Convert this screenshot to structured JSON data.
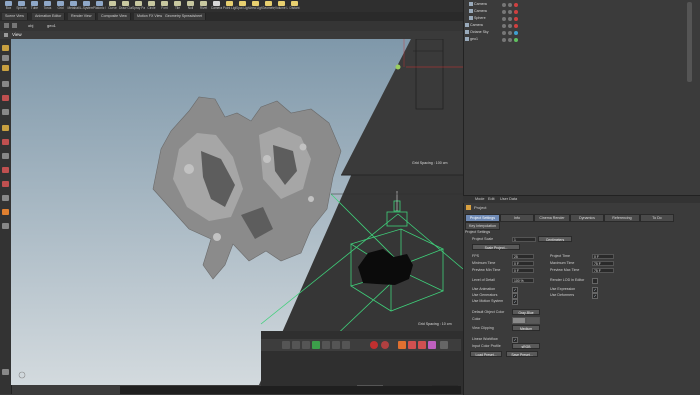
{
  "shelf": {
    "tools": [
      {
        "label": "Box",
        "icon": "box-icon",
        "color": "#8fa8c8"
      },
      {
        "label": "Sphere",
        "icon": "sphere-icon",
        "color": "#8fa8c8"
      },
      {
        "label": "Tube",
        "icon": "tube-icon",
        "color": "#8fa8c8"
      },
      {
        "label": "Torus",
        "icon": "torus-icon",
        "color": "#8fa8c8"
      },
      {
        "label": "Grid",
        "icon": "grid-icon",
        "color": "#8fa8c8"
      },
      {
        "label": "Metaball",
        "icon": "metaball-icon",
        "color": "#8fa8c8"
      },
      {
        "label": "L-System",
        "icon": "lsystem-icon",
        "color": "#8fa8c8"
      },
      {
        "label": "Platonic Sol",
        "icon": "platonic-icon",
        "color": "#8fa8c8"
      },
      {
        "label": "Curve",
        "icon": "curve-icon",
        "color": "#c8c8a0"
      },
      {
        "label": "Draw Curve",
        "icon": "draw-curve-icon",
        "color": "#c8c8a0"
      },
      {
        "label": "Spray Paint",
        "icon": "spray-paint-icon",
        "color": "#c8c8a0"
      },
      {
        "label": "Circle",
        "icon": "circle-icon",
        "color": "#c8c8a0"
      },
      {
        "label": "Font",
        "icon": "font-icon",
        "color": "#c8c8a0"
      },
      {
        "label": "Tile",
        "icon": "tile-icon",
        "color": "#c8c8a0"
      },
      {
        "label": "Null",
        "icon": "null-icon",
        "color": "#c8c8a0"
      },
      {
        "label": "Rivet",
        "icon": "rivet-icon",
        "color": "#c8c8a0"
      },
      {
        "label": "Camera",
        "icon": "camera-icon",
        "color": "#d8d8d8"
      },
      {
        "label": "Point Light",
        "icon": "point-light-icon",
        "color": "#e8d070"
      },
      {
        "label": "Spot Light",
        "icon": "spot-light-icon",
        "color": "#e8d070"
      },
      {
        "label": "Area Light",
        "icon": "area-light-icon",
        "color": "#e8d070"
      },
      {
        "label": "Geometry L",
        "icon": "geometry-light-icon",
        "color": "#e8d070"
      },
      {
        "label": "Volume Light",
        "icon": "volume-light-icon",
        "color": "#e8d070"
      },
      {
        "label": "Distant",
        "icon": "distant-light-icon",
        "color": "#e8d070"
      }
    ]
  },
  "tabs": [
    "Scene View",
    "Animation Editor",
    "Render View",
    "Composite View",
    "Motion FX View",
    "Geometry Spreadsheet"
  ],
  "path": {
    "node": "obj",
    "geo": "geo1"
  },
  "viewport": {
    "title": "View",
    "grid_spacing_top": "Grid Spacing : 100 cm",
    "grid_spacing_bottom": "Grid Spacing : 10 cm"
  },
  "outliner": {
    "items": [
      {
        "name": "Camera",
        "color": "#d04040"
      },
      {
        "name": "Camera",
        "color": "#d04040"
      },
      {
        "name": "Sphere",
        "color": "#d04040"
      },
      {
        "name": "Camera",
        "color": "#d04040"
      },
      {
        "name": "Octane Sky",
        "color": "#40a0d0"
      },
      {
        "name": "geo1",
        "color": "#60c060"
      }
    ]
  },
  "params": {
    "menu": [
      "Mode",
      "Edit",
      "User Data"
    ],
    "header": "Project",
    "tabs": [
      "Project Settings",
      "Info",
      "Cinema Render",
      "Dynamics",
      "Referencing",
      "To Do"
    ],
    "subtab": "Key Interpolation",
    "section": "Project Settings",
    "project_scale_label": "Project Scale",
    "project_scale_value": "1",
    "project_scale_unit": "Centimeters",
    "scale_project_btn": "Scale Project...",
    "fps_label": "FPS",
    "fps_value": "25",
    "project_time_label": "Project Time",
    "project_time_value": "0 F",
    "min_time_label": "Minimum Time",
    "min_time_value": "0 F",
    "max_time_label": "Maximum Time",
    "max_time_value": "75 F",
    "preview_min_label": "Preview Min Time",
    "preview_min_value": "0 F",
    "preview_max_label": "Preview Max Time",
    "preview_max_value": "75 F",
    "lod_label": "Level of Detail",
    "lod_value": "100 %",
    "render_lod_label": "Render LOD in Editor",
    "use_anim_label": "Use Animation",
    "use_expr_label": "Use Expression",
    "use_gen_label": "Use Generators",
    "use_deform_label": "Use Deformers",
    "use_motion_label": "Use Motion System",
    "default_color_label": "Default Object Color",
    "default_color_value": "Gray-Blue",
    "color_label": "Color",
    "view_clip_label": "View Clipping",
    "view_clip_value": "Medium",
    "linear_workflow_label": "Linear Workflow",
    "input_color_label": "Input Color Profile",
    "input_color_value": "sRGB",
    "load_preset_btn": "Load Preset...",
    "save_preset_btn": "Save Preset..."
  },
  "timeline": {
    "frame_field": "Object (Rel)",
    "apply_btn": "Apply"
  }
}
